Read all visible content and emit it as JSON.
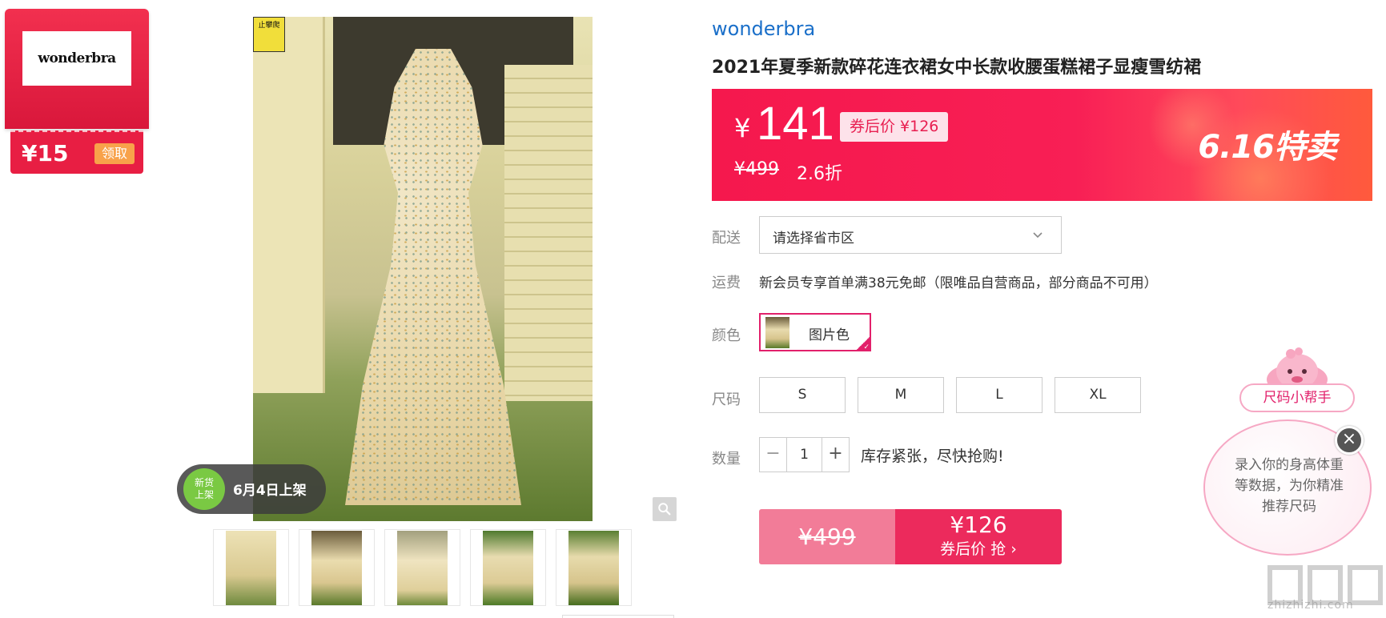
{
  "coupon": {
    "logo_text": "wonderbra",
    "amount": "¥15",
    "claim_label": "领取"
  },
  "gallery": {
    "sign_text": "止攀爬",
    "new_badge": {
      "circle_text_1": "新货",
      "circle_text_2": "上架",
      "label": "6月4日上架"
    },
    "thumbnails": [
      "thumb-1",
      "thumb-2",
      "thumb-3",
      "thumb-4",
      "thumb-5"
    ]
  },
  "product": {
    "brand": "wonderbra",
    "title": "2021年夏季新款碎花连衣裙女中长款收腰蛋糕裙子显瘦雪纺裙"
  },
  "price": {
    "currency": "¥",
    "now": "141",
    "coupon_price": "券后价 ¥126",
    "original": "¥499",
    "discount": "2.6折",
    "promo": "6.16特卖"
  },
  "shipping": {
    "label": "配送",
    "placeholder": "请选择省市区"
  },
  "freight": {
    "label": "运费",
    "text": "新会员专享首单满38元免邮（限唯品自营商品，部分商品不可用）"
  },
  "color": {
    "label": "颜色",
    "option": "图片色"
  },
  "size": {
    "label": "尺码",
    "options": [
      "S",
      "M",
      "L",
      "XL"
    ]
  },
  "quantity": {
    "label": "数量",
    "minus": "−",
    "value": "1",
    "plus": "+",
    "stock_text": "库存紧张，尽快抢购!"
  },
  "buy": {
    "original": "¥499",
    "coupon_price": "¥126",
    "action": "券后价 抢 ›"
  },
  "size_helper": {
    "tag": "尺码小帮手",
    "bubble_text": "录入你的身高体重等数据，为你精准推荐尺码",
    "close": "×"
  },
  "watermark": "zhizhizhi.com",
  "colors": {
    "accent": "#f5184d",
    "brand_blue": "#1a6fc9",
    "selected_border": "#e2206b"
  }
}
